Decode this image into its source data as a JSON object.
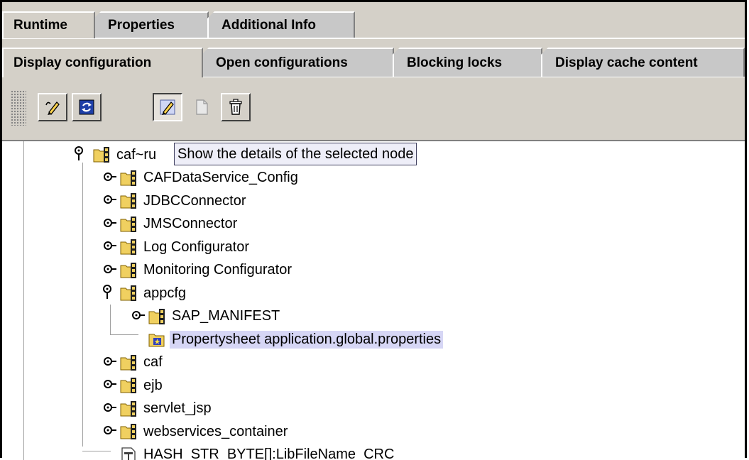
{
  "tabs_top": [
    {
      "label": "Runtime",
      "active": true
    },
    {
      "label": "Properties",
      "active": false
    },
    {
      "label": "Additional Info",
      "active": false
    }
  ],
  "tabs_sub": [
    {
      "label": "Display configuration",
      "active": true
    },
    {
      "label": "Open configurations",
      "active": false
    },
    {
      "label": "Blocking locks",
      "active": false
    },
    {
      "label": "Display cache content",
      "active": false
    }
  ],
  "toolbar": {
    "buttons": [
      {
        "name": "edit-mode-icon",
        "enabled": true
      },
      {
        "name": "refresh-icon",
        "enabled": true
      },
      {
        "name": "pencil-icon",
        "enabled": true,
        "pressed": true
      },
      {
        "name": "document-icon",
        "enabled": false
      },
      {
        "name": "trash-icon",
        "enabled": true
      }
    ]
  },
  "tooltip": {
    "text": "Show the details of the selected node"
  },
  "tree": {
    "root_label": "caf~ru",
    "children": [
      "CAFDataService_Config",
      "JDBCConnector",
      "JMSConnector",
      "Log Configurator",
      "Monitoring Configurator"
    ],
    "appcfg": {
      "label": "appcfg",
      "children": [
        {
          "label": "SAP_MANIFEST",
          "type": "folder"
        },
        {
          "label": "Propertysheet application.global.properties",
          "type": "propertysheet",
          "selected": true
        }
      ]
    },
    "children_after": [
      "caf",
      "ejb",
      "servlet_jsp",
      "webservices_container"
    ],
    "leaf": {
      "label": "HASH_STR_BYTE[]:LibFileName_CRC",
      "type": "file"
    }
  },
  "colors": {
    "panel": "#d4d0c8",
    "selection": "#d6d6f5",
    "tooltip_bg": "#eeeef8"
  }
}
